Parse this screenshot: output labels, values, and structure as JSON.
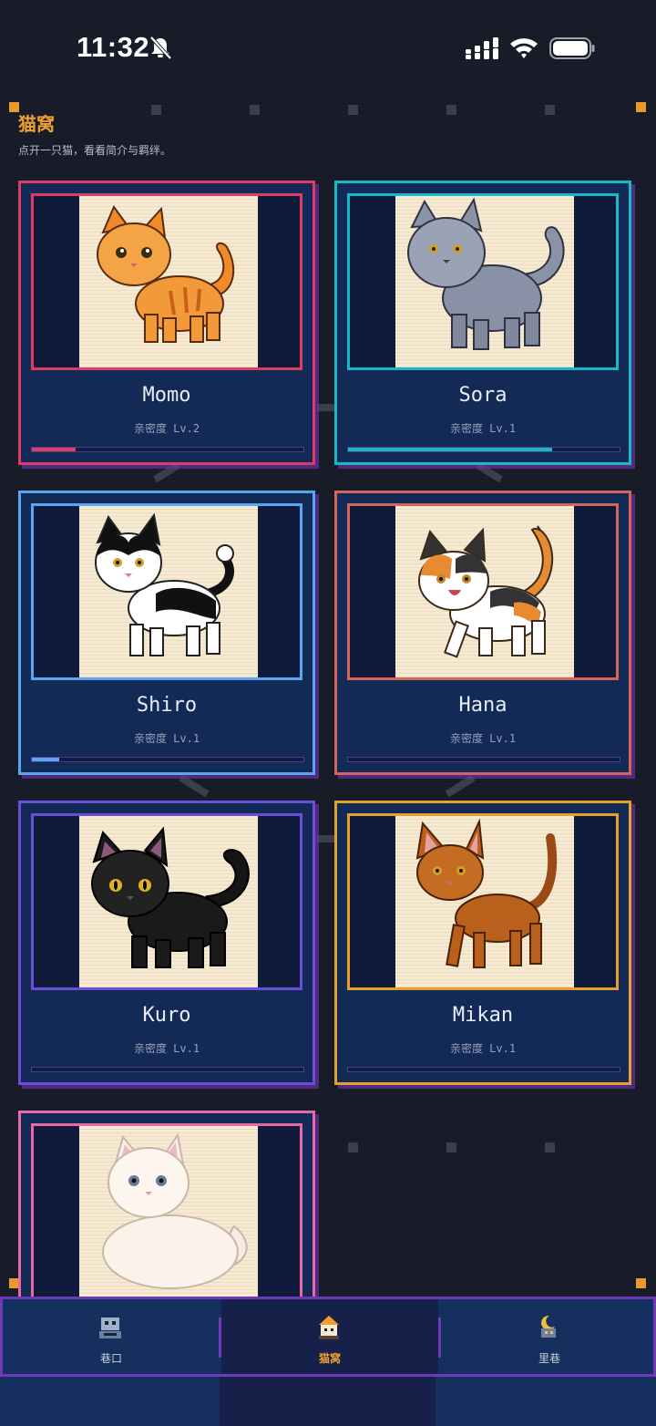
{
  "status_bar": {
    "time": "11:32",
    "icons": [
      "bell-slash-icon",
      "cellular-signal-icon",
      "wifi-icon",
      "battery-icon"
    ]
  },
  "header": {
    "title": "猫窝",
    "subtitle": "点开一只猫，看看简介与羁绊。"
  },
  "cats": [
    {
      "name": "Momo",
      "affinity": "亲密度 Lv.2",
      "affinity_progress": 0.16,
      "accent": "#dc3d64",
      "breed_look": "orange-tabby"
    },
    {
      "name": "Sora",
      "affinity": "亲密度 Lv.1",
      "affinity_progress": 0.75,
      "accent": "#17b9c8",
      "breed_look": "grey-fluffy"
    },
    {
      "name": "Shiro",
      "affinity": "亲密度 Lv.1",
      "affinity_progress": 0.1,
      "accent": "#5ba6f2",
      "breed_look": "black-white"
    },
    {
      "name": "Hana",
      "affinity": "亲密度 Lv.1",
      "affinity_progress": 0.0,
      "accent": "#d4655a",
      "breed_look": "calico"
    },
    {
      "name": "Kuro",
      "affinity": "亲密度 Lv.1",
      "affinity_progress": 0.0,
      "accent": "#6a4fd6",
      "breed_look": "black"
    },
    {
      "name": "Mikan",
      "affinity": "亲密度 Lv.1",
      "affinity_progress": 0.0,
      "accent": "#e8a02d",
      "breed_look": "abyssinian"
    },
    {
      "name": "",
      "affinity": "",
      "affinity_progress": 0.0,
      "accent": "#e86aa4",
      "breed_look": "white-fluffy"
    }
  ],
  "bottom_nav": {
    "tabs": [
      {
        "label": "巷口",
        "icon": "robot-icon",
        "active": false
      },
      {
        "label": "猫窝",
        "icon": "cat-house-icon",
        "active": true
      },
      {
        "label": "里巷",
        "icon": "moon-lantern-icon",
        "active": false
      }
    ]
  },
  "colors": {
    "background": "#171b27",
    "title_accent": "#f0a030",
    "card_fill": "#122a55",
    "nav_border": "#6e3bb8"
  }
}
